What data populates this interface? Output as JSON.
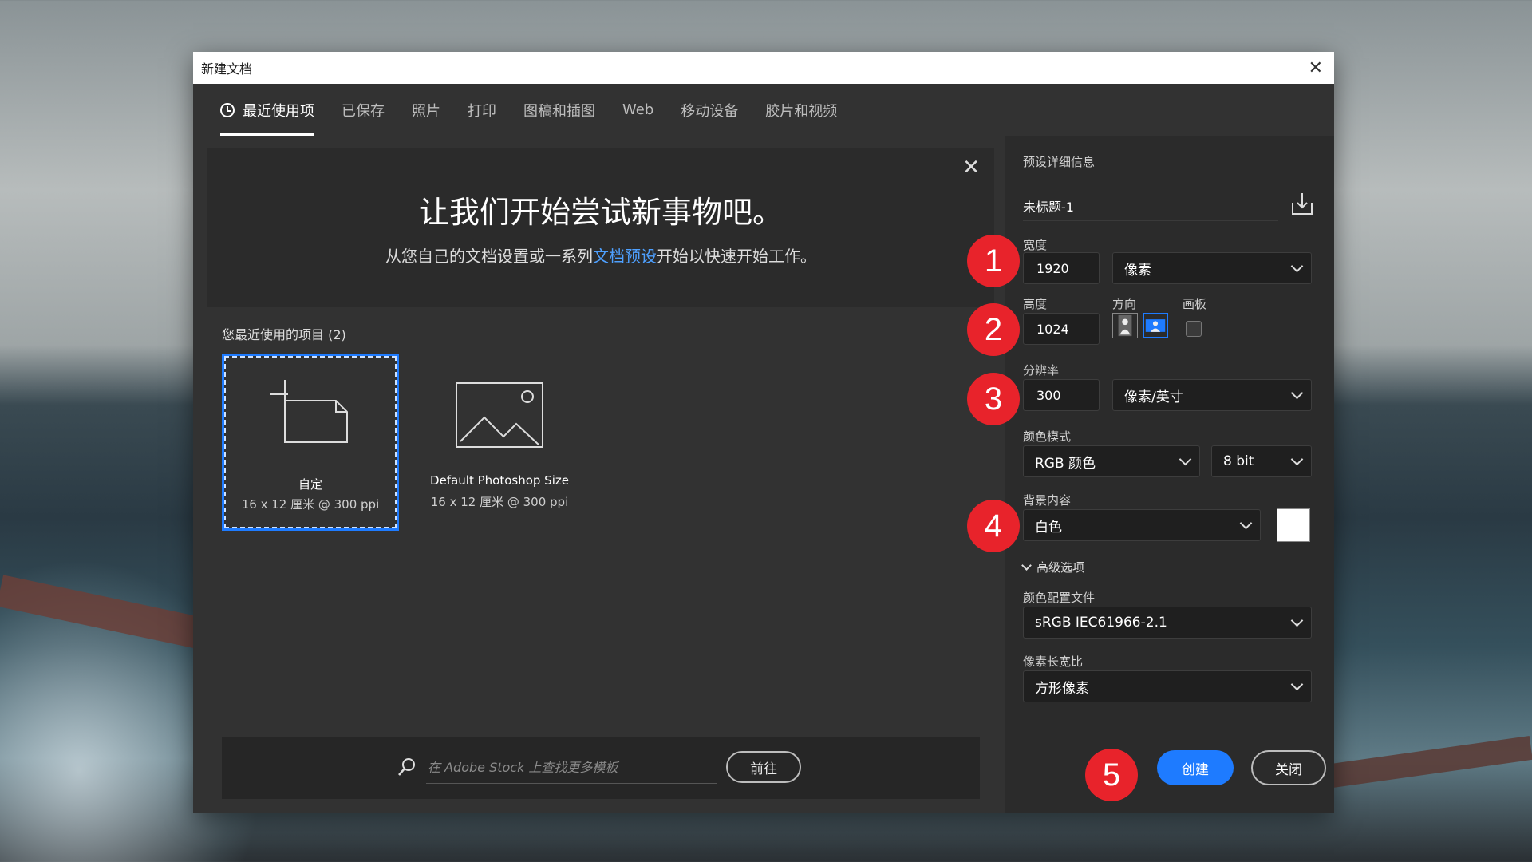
{
  "dialog": {
    "title": "新建文档",
    "close_symbol": "✕"
  },
  "tabs": [
    {
      "label": "最近使用项",
      "active": true
    },
    {
      "label": "已保存"
    },
    {
      "label": "照片"
    },
    {
      "label": "打印"
    },
    {
      "label": "图稿和插图"
    },
    {
      "label": "Web"
    },
    {
      "label": "移动设备"
    },
    {
      "label": "胶片和视频"
    }
  ],
  "banner": {
    "heading": "让我们开始尝试新事物吧。",
    "sub_before": "从您自己的文档设置或一系列",
    "sub_link": "文档预设",
    "sub_after": "开始以快速开始工作。",
    "close_symbol": "✕"
  },
  "recent": {
    "heading": "您最近使用的项目 (2)",
    "items": [
      {
        "title": "自定",
        "subtitle": "16 x 12 厘米 @ 300 ppi"
      },
      {
        "title": "Default Photoshop Size",
        "subtitle": "16 x 12 厘米 @ 300 ppi"
      }
    ]
  },
  "stock": {
    "placeholder": "在 Adobe Stock 上查找更多模板",
    "go_label": "前往"
  },
  "preset": {
    "section_label": "预设详细信息",
    "name": "未标题-1",
    "width_label": "宽度",
    "width_value": "1920",
    "width_unit": "像素",
    "height_label": "高度",
    "height_value": "1024",
    "orientation_label": "方向",
    "artboard_label": "画板",
    "resolution_label": "分辨率",
    "resolution_value": "300",
    "resolution_unit": "像素/英寸",
    "color_mode_label": "颜色模式",
    "color_mode": "RGB 颜色",
    "bit_depth": "8 bit",
    "background_label": "背景内容",
    "background": "白色",
    "background_color": "#ffffff",
    "advanced_label": "高级选项",
    "color_profile_label": "颜色配置文件",
    "color_profile": "sRGB IEC61966-2.1",
    "pixel_aspect_label": "像素长宽比",
    "pixel_aspect": "方形像素"
  },
  "actions": {
    "create": "创建",
    "close": "关闭"
  },
  "badges": [
    "1",
    "2",
    "3",
    "4",
    "5"
  ],
  "colors": {
    "accent": "#1e7bff",
    "badge": "#e8232b",
    "dialog_bg": "#323232"
  }
}
